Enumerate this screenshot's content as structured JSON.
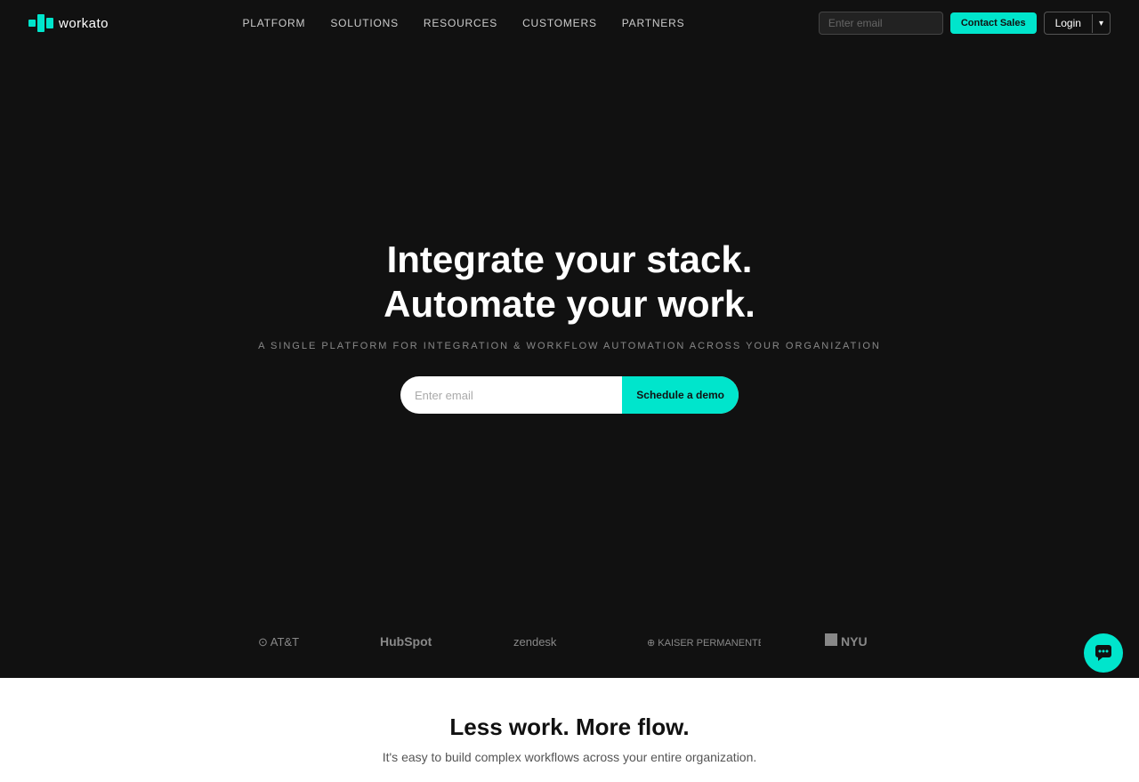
{
  "nav": {
    "logo_text": "workato",
    "links": [
      {
        "id": "platform",
        "label": "PLATFORM"
      },
      {
        "id": "solutions",
        "label": "SOLUTIONS"
      },
      {
        "id": "resources",
        "label": "RESOURCES"
      },
      {
        "id": "customers",
        "label": "CUSTOMERS"
      },
      {
        "id": "partners",
        "label": "PARTNERS"
      }
    ],
    "email_placeholder": "Enter email",
    "contact_sales_label": "Contact Sales",
    "login_label": "Login",
    "login_dropdown_icon": "▾"
  },
  "hero": {
    "headline_part1": "Integrate your stack.",
    "headline_part2": "Automate your work.",
    "subtitle": "A SINGLE PLATFORM FOR INTEGRATION & WORKFLOW AUTOMATION ACROSS YOUR ORGANIZATION",
    "email_placeholder": "Enter email",
    "cta_label": "Schedule a demo"
  },
  "logos": [
    {
      "id": "att",
      "text": "AT&T"
    },
    {
      "id": "hubspot",
      "text": "HubSpot"
    },
    {
      "id": "zendesk",
      "text": "zendesk"
    },
    {
      "id": "kaiser",
      "text": "KAISER PERMANENTE."
    },
    {
      "id": "nyu",
      "text": "■ NYU"
    }
  ],
  "bottom": {
    "heading": "Less work. More flow.",
    "subtext": "It's easy to build complex workflows across your entire organization."
  },
  "chat": {
    "icon": "💬"
  }
}
